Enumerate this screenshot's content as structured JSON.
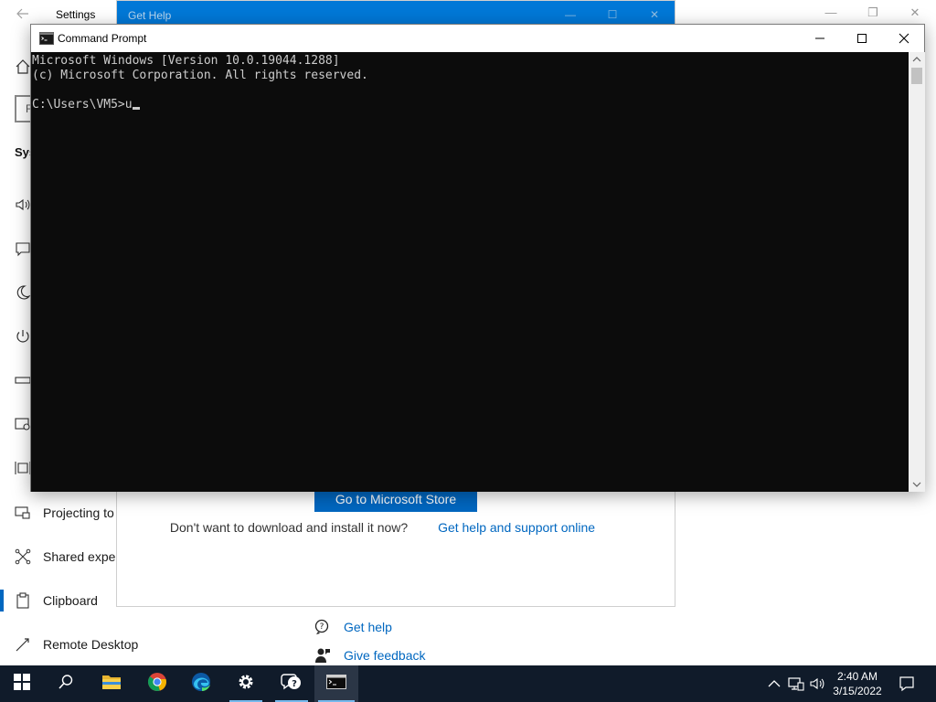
{
  "settings": {
    "title": "Settings",
    "partial_search": "F",
    "partial_heading": "Sys",
    "sidebar": [
      {
        "label": "Projecting to this PC",
        "icon": "projecting-icon"
      },
      {
        "label": "Shared experiences",
        "icon": "shared-experiences-icon"
      },
      {
        "label": "Clipboard",
        "icon": "clipboard-icon",
        "active": true
      },
      {
        "label": "Remote Desktop",
        "icon": "remote-desktop-icon"
      }
    ],
    "help_links": [
      {
        "label": "Get help",
        "icon": "get-help-icon"
      },
      {
        "label": "Give feedback",
        "icon": "give-feedback-icon"
      }
    ]
  },
  "get_help": {
    "title": "Get Help",
    "store_button": "Go to Microsoft Store",
    "message_prefix": "Don't want to download and install it now?",
    "message_link": "Get help and support online"
  },
  "cmd": {
    "title": "Command Prompt",
    "lines": [
      "Microsoft Windows [Version 10.0.19044.1288]",
      "(c) Microsoft Corporation. All rights reserved.",
      ""
    ],
    "prompt": "C:\\Users\\VM5>",
    "input": "u"
  },
  "taskbar": {
    "time": "2:40 AM",
    "date": "3/15/2022",
    "apps": [
      "start-icon",
      "search-icon",
      "file-explorer-icon",
      "chrome-icon",
      "edge-icon",
      "settings-gear-icon",
      "get-help-icon",
      "command-prompt-icon"
    ]
  },
  "colors": {
    "accent": "#0067c0",
    "taskbar": "#101b2a",
    "console_bg": "#0c0c0c",
    "console_fg": "#cccccc",
    "get_help_titlebar": "#0078d7"
  }
}
